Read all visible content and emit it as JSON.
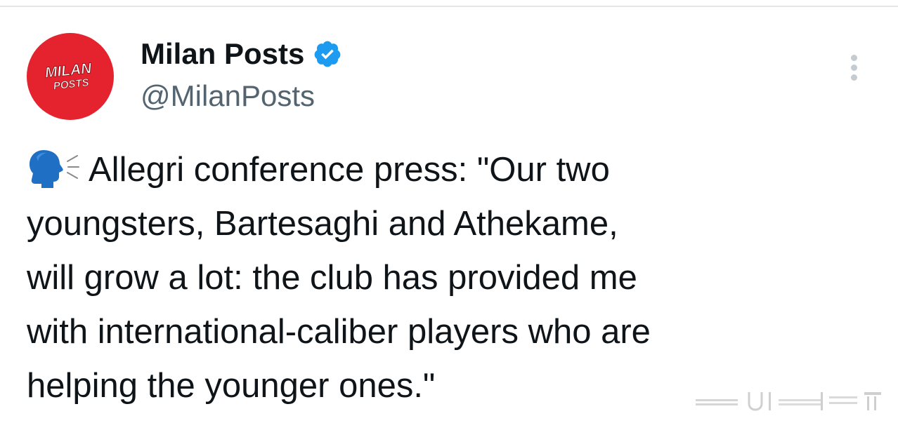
{
  "author": {
    "avatar_text": [
      "MILAN",
      "POSTS"
    ],
    "display_name": "Milan Posts",
    "handle": "@MilanPosts",
    "verified_icon": "verified-badge-icon",
    "avatar_color": "#e4232e",
    "verified_color": "#1d9bf0"
  },
  "tweet": {
    "lead_icon": "speaking-head-icon",
    "lines": [
      "Allegri conference press: \"Our two",
      "youngsters, Bartesaghi and Athekame,",
      "will grow a lot: the club has provided me",
      "with international-caliber players who are",
      "helping the younger ones.\""
    ]
  },
  "menu": {
    "more_icon": "more-vertical-icon"
  }
}
